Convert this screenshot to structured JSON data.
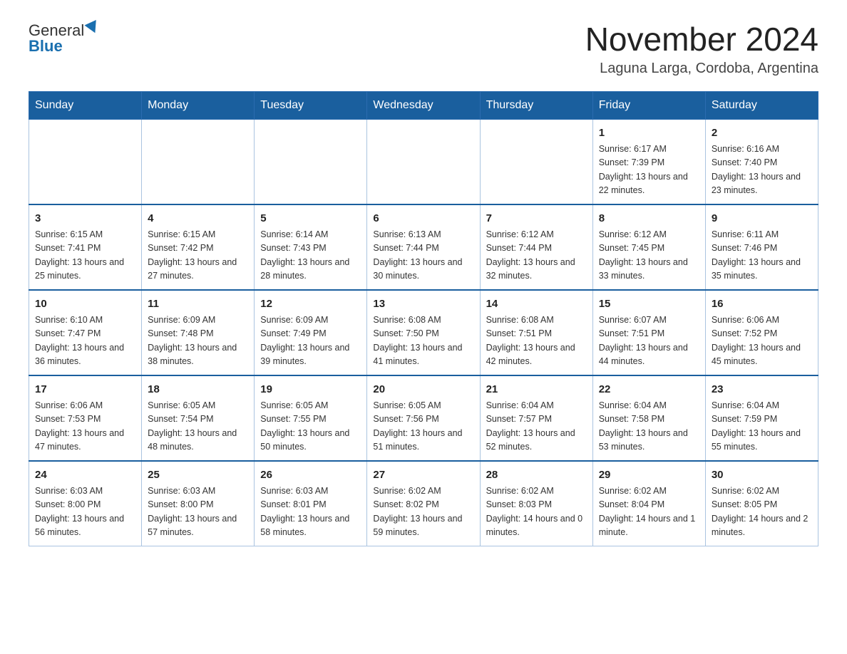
{
  "logo": {
    "general": "General",
    "blue": "Blue"
  },
  "title": "November 2024",
  "subtitle": "Laguna Larga, Cordoba, Argentina",
  "weekdays": [
    "Sunday",
    "Monday",
    "Tuesday",
    "Wednesday",
    "Thursday",
    "Friday",
    "Saturday"
  ],
  "weeks": [
    [
      {
        "day": "",
        "sunrise": "",
        "sunset": "",
        "daylight": ""
      },
      {
        "day": "",
        "sunrise": "",
        "sunset": "",
        "daylight": ""
      },
      {
        "day": "",
        "sunrise": "",
        "sunset": "",
        "daylight": ""
      },
      {
        "day": "",
        "sunrise": "",
        "sunset": "",
        "daylight": ""
      },
      {
        "day": "",
        "sunrise": "",
        "sunset": "",
        "daylight": ""
      },
      {
        "day": "1",
        "sunrise": "Sunrise: 6:17 AM",
        "sunset": "Sunset: 7:39 PM",
        "daylight": "Daylight: 13 hours and 22 minutes."
      },
      {
        "day": "2",
        "sunrise": "Sunrise: 6:16 AM",
        "sunset": "Sunset: 7:40 PM",
        "daylight": "Daylight: 13 hours and 23 minutes."
      }
    ],
    [
      {
        "day": "3",
        "sunrise": "Sunrise: 6:15 AM",
        "sunset": "Sunset: 7:41 PM",
        "daylight": "Daylight: 13 hours and 25 minutes."
      },
      {
        "day": "4",
        "sunrise": "Sunrise: 6:15 AM",
        "sunset": "Sunset: 7:42 PM",
        "daylight": "Daylight: 13 hours and 27 minutes."
      },
      {
        "day": "5",
        "sunrise": "Sunrise: 6:14 AM",
        "sunset": "Sunset: 7:43 PM",
        "daylight": "Daylight: 13 hours and 28 minutes."
      },
      {
        "day": "6",
        "sunrise": "Sunrise: 6:13 AM",
        "sunset": "Sunset: 7:44 PM",
        "daylight": "Daylight: 13 hours and 30 minutes."
      },
      {
        "day": "7",
        "sunrise": "Sunrise: 6:12 AM",
        "sunset": "Sunset: 7:44 PM",
        "daylight": "Daylight: 13 hours and 32 minutes."
      },
      {
        "day": "8",
        "sunrise": "Sunrise: 6:12 AM",
        "sunset": "Sunset: 7:45 PM",
        "daylight": "Daylight: 13 hours and 33 minutes."
      },
      {
        "day": "9",
        "sunrise": "Sunrise: 6:11 AM",
        "sunset": "Sunset: 7:46 PM",
        "daylight": "Daylight: 13 hours and 35 minutes."
      }
    ],
    [
      {
        "day": "10",
        "sunrise": "Sunrise: 6:10 AM",
        "sunset": "Sunset: 7:47 PM",
        "daylight": "Daylight: 13 hours and 36 minutes."
      },
      {
        "day": "11",
        "sunrise": "Sunrise: 6:09 AM",
        "sunset": "Sunset: 7:48 PM",
        "daylight": "Daylight: 13 hours and 38 minutes."
      },
      {
        "day": "12",
        "sunrise": "Sunrise: 6:09 AM",
        "sunset": "Sunset: 7:49 PM",
        "daylight": "Daylight: 13 hours and 39 minutes."
      },
      {
        "day": "13",
        "sunrise": "Sunrise: 6:08 AM",
        "sunset": "Sunset: 7:50 PM",
        "daylight": "Daylight: 13 hours and 41 minutes."
      },
      {
        "day": "14",
        "sunrise": "Sunrise: 6:08 AM",
        "sunset": "Sunset: 7:51 PM",
        "daylight": "Daylight: 13 hours and 42 minutes."
      },
      {
        "day": "15",
        "sunrise": "Sunrise: 6:07 AM",
        "sunset": "Sunset: 7:51 PM",
        "daylight": "Daylight: 13 hours and 44 minutes."
      },
      {
        "day": "16",
        "sunrise": "Sunrise: 6:06 AM",
        "sunset": "Sunset: 7:52 PM",
        "daylight": "Daylight: 13 hours and 45 minutes."
      }
    ],
    [
      {
        "day": "17",
        "sunrise": "Sunrise: 6:06 AM",
        "sunset": "Sunset: 7:53 PM",
        "daylight": "Daylight: 13 hours and 47 minutes."
      },
      {
        "day": "18",
        "sunrise": "Sunrise: 6:05 AM",
        "sunset": "Sunset: 7:54 PM",
        "daylight": "Daylight: 13 hours and 48 minutes."
      },
      {
        "day": "19",
        "sunrise": "Sunrise: 6:05 AM",
        "sunset": "Sunset: 7:55 PM",
        "daylight": "Daylight: 13 hours and 50 minutes."
      },
      {
        "day": "20",
        "sunrise": "Sunrise: 6:05 AM",
        "sunset": "Sunset: 7:56 PM",
        "daylight": "Daylight: 13 hours and 51 minutes."
      },
      {
        "day": "21",
        "sunrise": "Sunrise: 6:04 AM",
        "sunset": "Sunset: 7:57 PM",
        "daylight": "Daylight: 13 hours and 52 minutes."
      },
      {
        "day": "22",
        "sunrise": "Sunrise: 6:04 AM",
        "sunset": "Sunset: 7:58 PM",
        "daylight": "Daylight: 13 hours and 53 minutes."
      },
      {
        "day": "23",
        "sunrise": "Sunrise: 6:04 AM",
        "sunset": "Sunset: 7:59 PM",
        "daylight": "Daylight: 13 hours and 55 minutes."
      }
    ],
    [
      {
        "day": "24",
        "sunrise": "Sunrise: 6:03 AM",
        "sunset": "Sunset: 8:00 PM",
        "daylight": "Daylight: 13 hours and 56 minutes."
      },
      {
        "day": "25",
        "sunrise": "Sunrise: 6:03 AM",
        "sunset": "Sunset: 8:00 PM",
        "daylight": "Daylight: 13 hours and 57 minutes."
      },
      {
        "day": "26",
        "sunrise": "Sunrise: 6:03 AM",
        "sunset": "Sunset: 8:01 PM",
        "daylight": "Daylight: 13 hours and 58 minutes."
      },
      {
        "day": "27",
        "sunrise": "Sunrise: 6:02 AM",
        "sunset": "Sunset: 8:02 PM",
        "daylight": "Daylight: 13 hours and 59 minutes."
      },
      {
        "day": "28",
        "sunrise": "Sunrise: 6:02 AM",
        "sunset": "Sunset: 8:03 PM",
        "daylight": "Daylight: 14 hours and 0 minutes."
      },
      {
        "day": "29",
        "sunrise": "Sunrise: 6:02 AM",
        "sunset": "Sunset: 8:04 PM",
        "daylight": "Daylight: 14 hours and 1 minute."
      },
      {
        "day": "30",
        "sunrise": "Sunrise: 6:02 AM",
        "sunset": "Sunset: 8:05 PM",
        "daylight": "Daylight: 14 hours and 2 minutes."
      }
    ]
  ]
}
